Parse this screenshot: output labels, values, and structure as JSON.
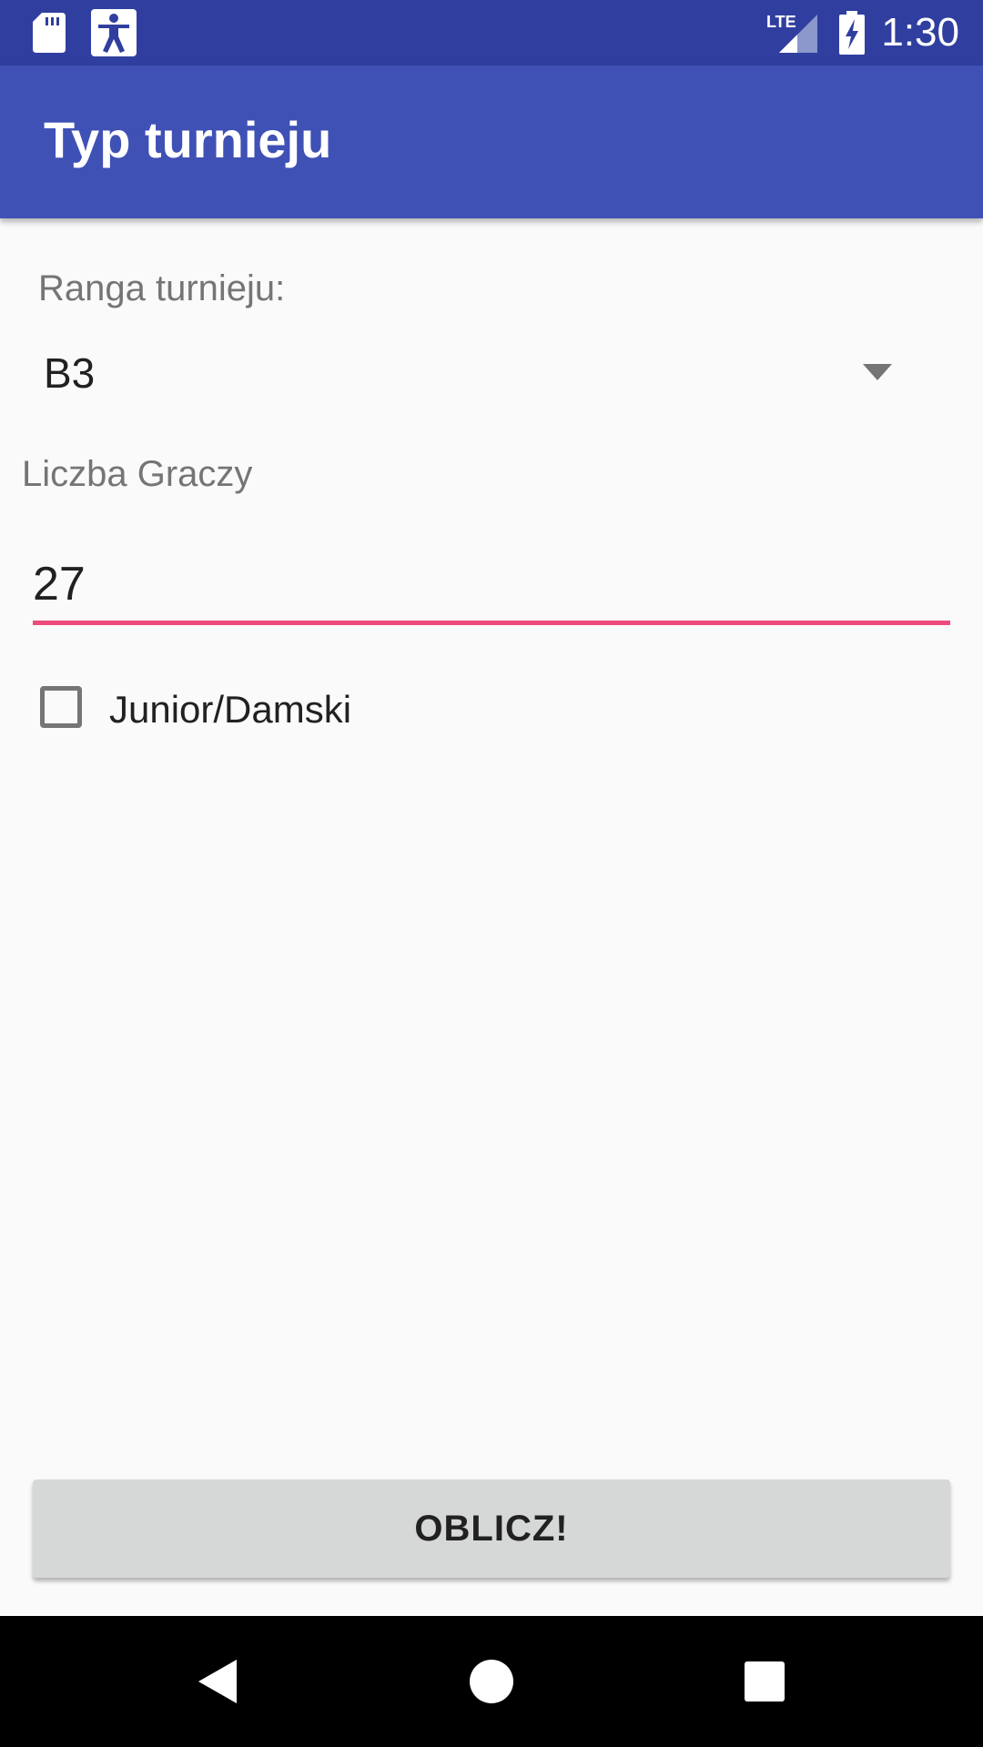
{
  "status_bar": {
    "time": "1:30",
    "network": "LTE",
    "icons": [
      "sd-card-icon",
      "accessibility-icon",
      "lte-signal-icon",
      "battery-charging-icon"
    ]
  },
  "app_bar": {
    "title": "Typ turnieju",
    "color": "#3f51b5"
  },
  "form": {
    "rank_label": "Ranga turnieju:",
    "rank_value": "B3",
    "players_label": "Liczba Graczy",
    "players_value": "27",
    "junior_checkbox_label": "Junior/Damski",
    "junior_checked": false,
    "accent_color": "#ee4c7c"
  },
  "actions": {
    "calculate_label": "OBLICZ!"
  },
  "nav_bar": {
    "icons": [
      "back-icon",
      "home-icon",
      "recent-apps-icon"
    ]
  }
}
